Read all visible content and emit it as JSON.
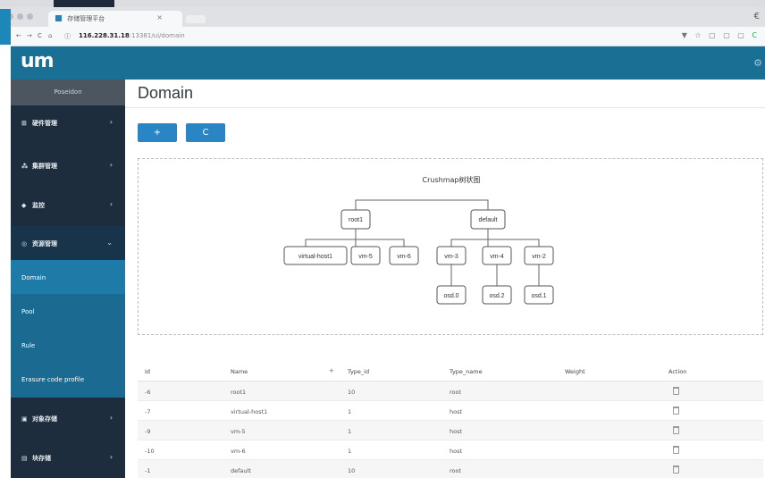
{
  "browser": {
    "tab_title": "存储管理平台",
    "tab_close": "×",
    "url_host": "116.228.31.18",
    "url_path": ":13381/ui/domain",
    "nav_glyphs": [
      "←",
      "→",
      "C",
      "⌂",
      "ⓘ"
    ],
    "right_glyphs": "▼ ☆ ▢ ▢ ▢",
    "right_green": "C",
    "edge_glyph": "€"
  },
  "app": {
    "logo": "um",
    "settings_glyph": "⚙",
    "brand_color": "#1a6f95"
  },
  "sidebar": {
    "user": "Poseidon",
    "items": [
      {
        "label": "硬件管理",
        "icon": "server-icon",
        "glyph": "⊞",
        "chevron": "›"
      },
      {
        "label": "集群管理",
        "icon": "cluster-icon",
        "glyph": "⁂",
        "chevron": "›"
      },
      {
        "label": "监控",
        "icon": "monitor-icon",
        "glyph": "◆",
        "chevron": "›"
      },
      {
        "label": "资源管理",
        "icon": "resource-icon",
        "glyph": "◎",
        "chevron": "⌄"
      }
    ],
    "subitems": [
      {
        "label": "Domain"
      },
      {
        "label": "Pool"
      },
      {
        "label": "Rule"
      },
      {
        "label": "Erasure code profile"
      }
    ],
    "bottom_items": [
      {
        "label": "对象存储",
        "icon": "object-storage-icon",
        "glyph": "▣",
        "chevron": "›"
      },
      {
        "label": "块存储",
        "icon": "block-storage-icon",
        "glyph": "▤",
        "chevron": "›"
      }
    ]
  },
  "page": {
    "title": "Domain",
    "add_label": "+",
    "refresh_label": "C"
  },
  "tree": {
    "title": "Crushmap树状图",
    "nodes": {
      "root1": "root1",
      "default": "default",
      "virtual_host1": "virtual-host1",
      "vm5": "vm-5",
      "vm6": "vm-6",
      "vm3": "vm-3",
      "vm4": "vm-4",
      "vm2": "vm-2",
      "osd0": "osd.0",
      "osd2": "osd.2",
      "osd1": "osd.1"
    }
  },
  "table": {
    "headers": {
      "id": "Id",
      "name": "Name",
      "sort": "+",
      "type_id": "Type_id",
      "type_name": "Type_name",
      "weight": "Weight",
      "action": "Action"
    },
    "rows": [
      {
        "id": "-6",
        "name": "root1",
        "type_id": "10",
        "type_name": "root",
        "weight": ""
      },
      {
        "id": "-7",
        "name": "virtual-host1",
        "type_id": "1",
        "type_name": "host",
        "weight": ""
      },
      {
        "id": "-9",
        "name": "vm-5",
        "type_id": "1",
        "type_name": "host",
        "weight": ""
      },
      {
        "id": "-10",
        "name": "vm-6",
        "type_id": "1",
        "type_name": "host",
        "weight": ""
      },
      {
        "id": "-1",
        "name": "default",
        "type_id": "10",
        "type_name": "root",
        "weight": ""
      }
    ]
  }
}
